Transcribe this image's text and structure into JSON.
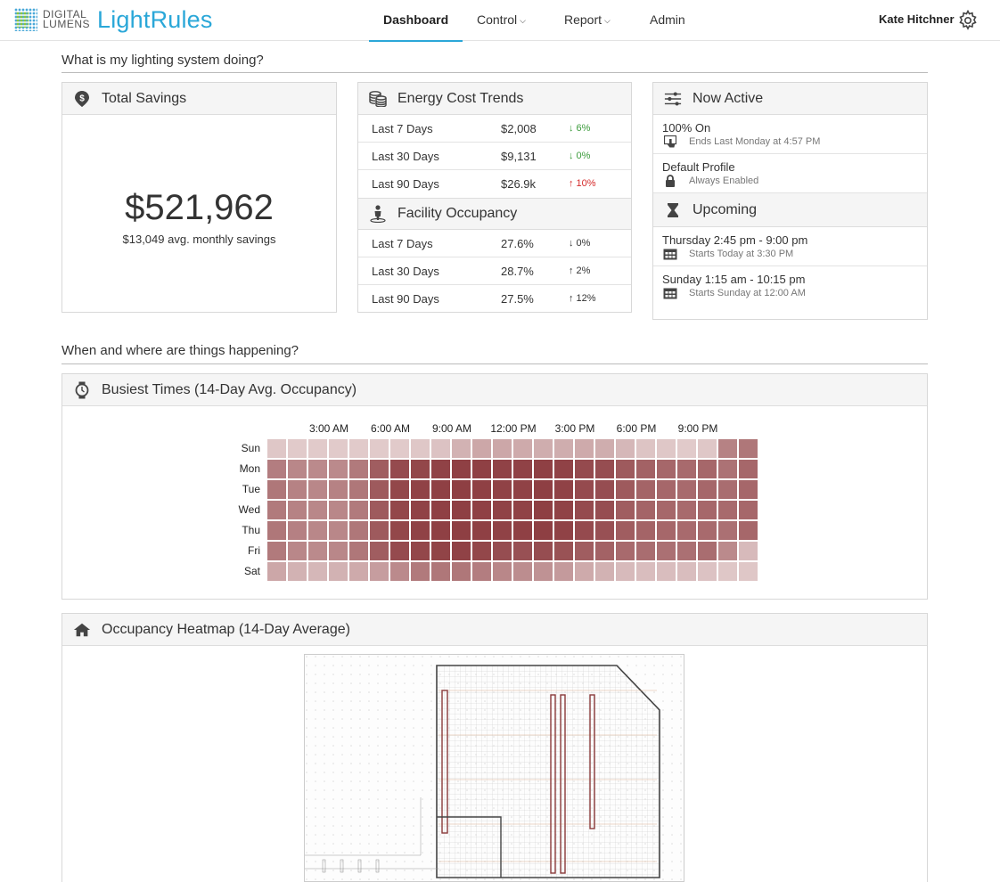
{
  "brand": {
    "top": "DIGITAL",
    "bottom": "LUMENS",
    "product": "LightRules"
  },
  "nav": {
    "items": [
      {
        "label": "Dashboard",
        "caret": false,
        "active": true
      },
      {
        "label": "Control",
        "caret": true,
        "active": false
      },
      {
        "label": "Report",
        "caret": true,
        "active": false
      },
      {
        "label": "Admin",
        "caret": false,
        "active": false
      }
    ]
  },
  "user": {
    "name": "Kate Hitchner"
  },
  "sections": {
    "status": "What is my lighting system doing?",
    "where": "When and where are things happening?"
  },
  "total_savings": {
    "title": "Total Savings",
    "amount": "$521,962",
    "avg": "$13,049 avg. monthly savings"
  },
  "energy_cost": {
    "title": "Energy Cost Trends",
    "rows": [
      {
        "period": "Last 7 Days",
        "value": "$2,008",
        "change": "↓ 6%",
        "dir": "down-green"
      },
      {
        "period": "Last 30 Days",
        "value": "$9,131",
        "change": "↓ 0%",
        "dir": "down-green"
      },
      {
        "period": "Last 90 Days",
        "value": "$26.9k",
        "change": "↑ 10%",
        "dir": "up-red"
      }
    ]
  },
  "facility_occupancy": {
    "title": "Facility Occupancy",
    "rows": [
      {
        "period": "Last 7 Days",
        "value": "27.6%",
        "change": "↓ 0%",
        "dir": "neutral"
      },
      {
        "period": "Last 30 Days",
        "value": "28.7%",
        "change": "↑ 2%",
        "dir": "neutral"
      },
      {
        "period": "Last 90 Days",
        "value": "27.5%",
        "change": "↑ 12%",
        "dir": "neutral"
      }
    ]
  },
  "now_active": {
    "title": "Now Active",
    "items": [
      {
        "title": "100% On",
        "sub": "Ends Last Monday at 4:57 PM",
        "icon": "hand-pointer-icon"
      },
      {
        "title": "Default Profile",
        "sub": "Always Enabled",
        "icon": "lock-icon"
      }
    ]
  },
  "upcoming": {
    "title": "Upcoming",
    "items": [
      {
        "title": "Thursday 2:45 pm - 9:00 pm",
        "sub": "Starts Today at 3:30 PM",
        "icon": "calendar-icon"
      },
      {
        "title": "Sunday 1:15 am - 10:15 pm",
        "sub": "Starts Sunday at 12:00 AM",
        "icon": "calendar-icon"
      }
    ]
  },
  "busiest_times": {
    "title": "Busiest Times (14-Day Avg. Occupancy)"
  },
  "occupancy_heatmap": {
    "title": "Occupancy Heatmap (14-Day Average)"
  },
  "colors": {
    "accent": "#2aa7d8",
    "heat_low": "#eadada",
    "heat_high": "#8b3a3e",
    "up": "#d52b2b",
    "down": "#3c9b3c"
  },
  "chart_data": {
    "type": "heatmap",
    "title": "Busiest Times (14-Day Avg. Occupancy)",
    "x_tick_labels": [
      "3:00 AM",
      "6:00 AM",
      "9:00 AM",
      "12:00 PM",
      "3:00 PM",
      "6:00 PM",
      "9:00 PM"
    ],
    "x_tick_hours": [
      3,
      6,
      9,
      12,
      15,
      18,
      21
    ],
    "hours": [
      0,
      1,
      2,
      3,
      4,
      5,
      6,
      7,
      8,
      9,
      10,
      11,
      12,
      13,
      14,
      15,
      16,
      17,
      18,
      19,
      20,
      21,
      22,
      23
    ],
    "days": [
      "Sun",
      "Mon",
      "Tue",
      "Wed",
      "Thu",
      "Fri",
      "Sat"
    ],
    "scale": [
      0,
      1
    ],
    "values": [
      [
        0.12,
        0.1,
        0.1,
        0.1,
        0.1,
        0.1,
        0.1,
        0.12,
        0.15,
        0.25,
        0.32,
        0.32,
        0.3,
        0.28,
        0.28,
        0.3,
        0.28,
        0.22,
        0.14,
        0.12,
        0.1,
        0.12,
        0.55,
        0.62
      ],
      [
        0.58,
        0.52,
        0.5,
        0.5,
        0.6,
        0.78,
        0.9,
        0.92,
        0.95,
        0.96,
        0.96,
        0.95,
        0.95,
        0.96,
        0.95,
        0.9,
        0.88,
        0.8,
        0.75,
        0.72,
        0.7,
        0.72,
        0.65,
        0.72
      ],
      [
        0.62,
        0.55,
        0.52,
        0.55,
        0.62,
        0.8,
        0.92,
        0.95,
        0.96,
        0.97,
        0.96,
        0.95,
        0.95,
        0.97,
        0.95,
        0.9,
        0.88,
        0.8,
        0.74,
        0.72,
        0.7,
        0.72,
        0.68,
        0.72
      ],
      [
        0.6,
        0.55,
        0.52,
        0.52,
        0.6,
        0.8,
        0.92,
        0.95,
        0.96,
        0.97,
        0.96,
        0.95,
        0.95,
        0.97,
        0.95,
        0.9,
        0.88,
        0.78,
        0.74,
        0.72,
        0.7,
        0.72,
        0.7,
        0.72
      ],
      [
        0.62,
        0.56,
        0.52,
        0.52,
        0.62,
        0.8,
        0.92,
        0.95,
        0.96,
        0.97,
        0.96,
        0.95,
        0.96,
        0.97,
        0.95,
        0.9,
        0.86,
        0.78,
        0.74,
        0.72,
        0.7,
        0.7,
        0.66,
        0.72
      ],
      [
        0.6,
        0.52,
        0.5,
        0.52,
        0.62,
        0.78,
        0.9,
        0.92,
        0.94,
        0.95,
        0.92,
        0.88,
        0.86,
        0.88,
        0.85,
        0.78,
        0.75,
        0.7,
        0.68,
        0.66,
        0.66,
        0.68,
        0.5,
        0.2
      ],
      [
        0.32,
        0.25,
        0.22,
        0.25,
        0.3,
        0.38,
        0.5,
        0.6,
        0.62,
        0.62,
        0.58,
        0.52,
        0.48,
        0.45,
        0.4,
        0.3,
        0.25,
        0.2,
        0.18,
        0.18,
        0.18,
        0.15,
        0.12,
        0.12
      ]
    ]
  }
}
